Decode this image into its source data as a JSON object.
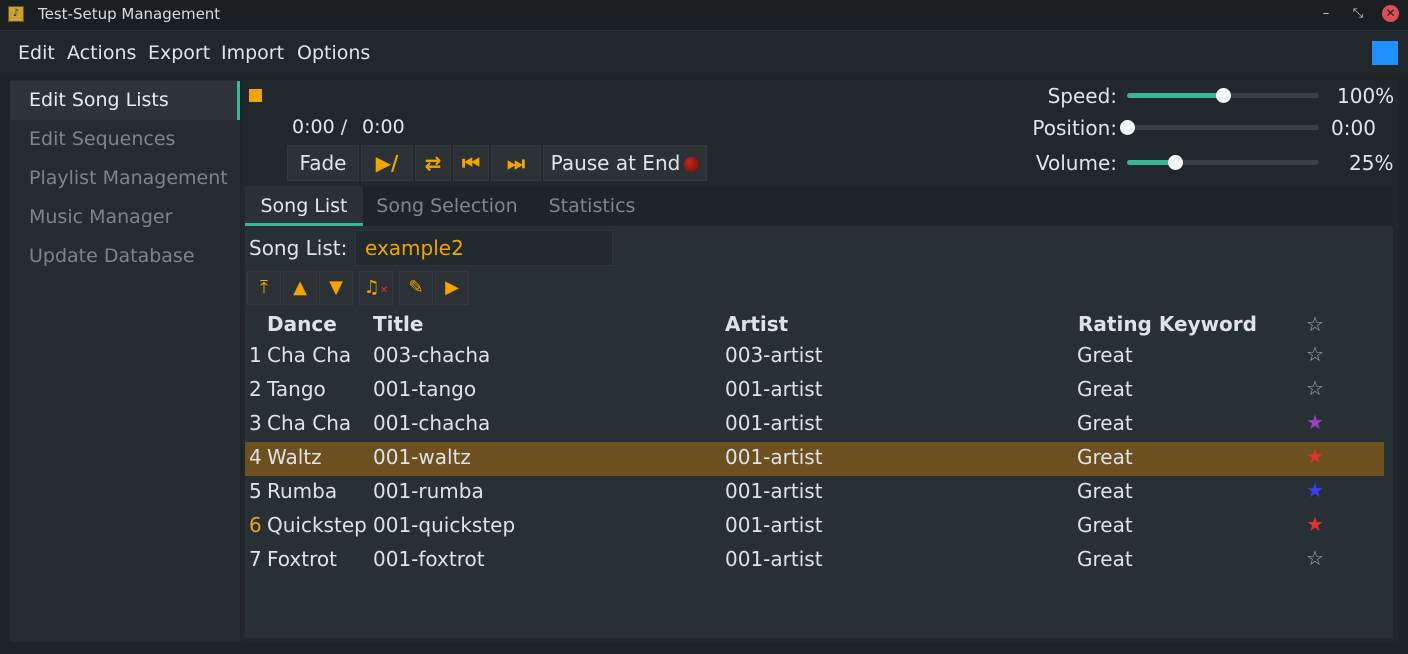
{
  "window": {
    "title": "Test-Setup Management",
    "icon": "app-icon",
    "minimize": "–",
    "maximize": "⤡",
    "close": "✕"
  },
  "menu": [
    "Edit",
    "Actions",
    "Export",
    "Import",
    "Options"
  ],
  "sidebar": {
    "items": [
      {
        "label": "Edit Song Lists",
        "active": true
      },
      {
        "label": "Edit Sequences",
        "active": false
      },
      {
        "label": "Playlist Management",
        "active": false
      },
      {
        "label": "Music Manager",
        "active": false
      },
      {
        "label": "Update Database",
        "active": false
      }
    ]
  },
  "player": {
    "elapsed": "0:00 /",
    "total": "0:00",
    "fade_label": "Fade",
    "pause_at_end_label": "Pause at End",
    "play_pause_icon": "▶/❚❚",
    "repeat_icon": "⇄",
    "prev_icon": "⏮",
    "next_icon": "⏭"
  },
  "sliders": {
    "speed": {
      "label": "Speed:",
      "value": "100%",
      "level": 0.5
    },
    "position": {
      "label": "Position:",
      "value": "0:00",
      "level": 0.0
    },
    "volume": {
      "label": "Volume:",
      "value": "25%",
      "level": 0.25
    }
  },
  "tabs": [
    {
      "label": "Song List",
      "active": true
    },
    {
      "label": "Song Selection",
      "active": false
    },
    {
      "label": "Statistics",
      "active": false
    }
  ],
  "song_list": {
    "label": "Song List:",
    "name": "example2",
    "toolbar_icons": [
      "move-top-icon",
      "move-up-icon",
      "move-down-icon",
      "remove-song-icon",
      "edit-icon",
      "play-icon"
    ]
  },
  "table": {
    "columns": [
      "Dance",
      "Title",
      "Artist",
      "Rating Keyword",
      "☆"
    ],
    "rows": [
      {
        "num": "1",
        "dance": "Cha Cha",
        "title": "003-chacha",
        "artist": "003-artist",
        "rating": "Great",
        "star": "☆",
        "star_color": "#aab0b5",
        "selected": false
      },
      {
        "num": "2",
        "dance": "Tango",
        "title": "001-tango",
        "artist": "001-artist",
        "rating": "Great",
        "star": "☆",
        "star_color": "#aab0b5",
        "selected": false
      },
      {
        "num": "3",
        "dance": "Cha Cha",
        "title": "001-chacha",
        "artist": "001-artist",
        "rating": "Great",
        "star": "★",
        "star_color": "#9b3fc0",
        "selected": false
      },
      {
        "num": "4",
        "dance": "Waltz",
        "title": "001-waltz",
        "artist": "001-artist",
        "rating": "Great",
        "star": "★",
        "star_color": "#e0322c",
        "selected": true
      },
      {
        "num": "5",
        "dance": "Rumba",
        "title": "001-rumba",
        "artist": "001-artist",
        "rating": "Great",
        "star": "★",
        "star_color": "#3a3ff0",
        "selected": false
      },
      {
        "num": "6",
        "dance": "Quickstep",
        "title": "001-quickstep",
        "artist": "001-artist",
        "rating": "Great",
        "star": "★",
        "star_color": "#e0322c",
        "selected": false,
        "num_highlight": true
      },
      {
        "num": "7",
        "dance": "Foxtrot",
        "title": "001-foxtrot",
        "artist": "001-artist",
        "rating": "Great",
        "star": "☆",
        "star_color": "#aab0b5",
        "selected": false
      }
    ]
  },
  "colors": {
    "accent": "#3bb59a",
    "highlight": "#f0a500",
    "selection": "#6c501f",
    "corner": "#1e90ff"
  }
}
